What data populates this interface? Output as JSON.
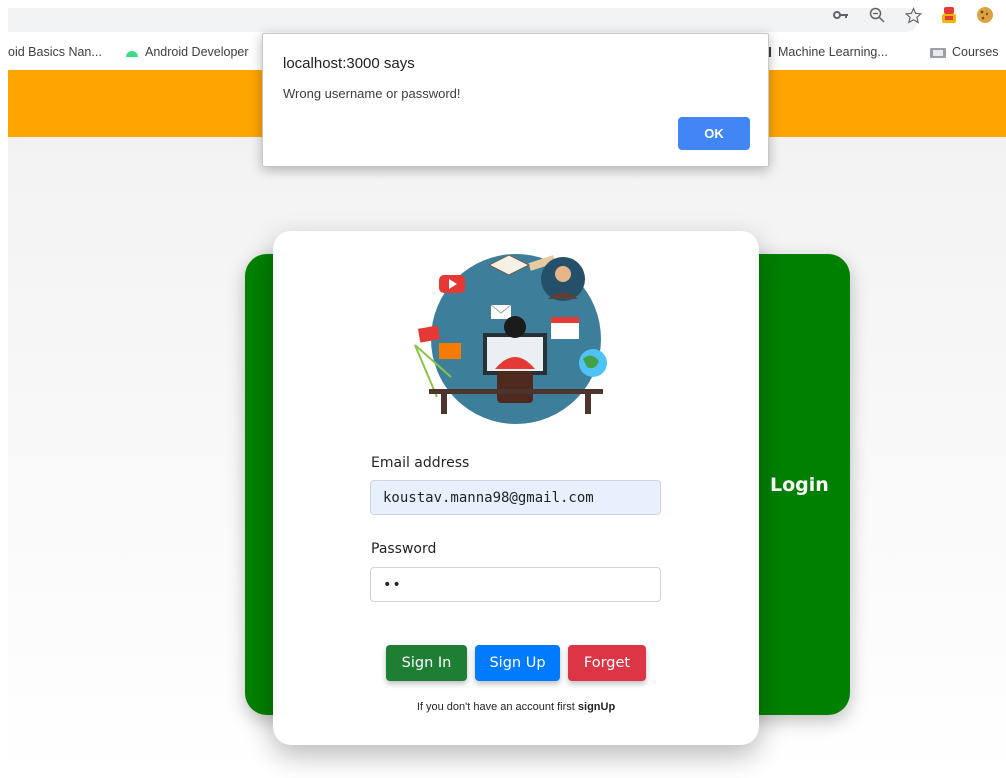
{
  "browser": {
    "bookmarks": [
      {
        "label": "oid Basics Nan...",
        "icon": "bookmark-icon"
      },
      {
        "label": "Android Developer",
        "icon": "android-icon"
      },
      {
        "label": "Machine Learning...",
        "icon": "folder-icon"
      },
      {
        "label": "Courses",
        "icon": "courses-icon"
      }
    ],
    "toolbar_icons": [
      "key-icon",
      "zoom-icon",
      "star-icon",
      "extension-icon",
      "cookie-icon"
    ]
  },
  "alert": {
    "title": "localhost:3000 says",
    "message": "Wrong username or password!",
    "ok_label": "OK"
  },
  "login": {
    "panel_title": "Login",
    "email_label": "Email address",
    "email_value": "koustav.manna98@gmail.com",
    "password_label": "Password",
    "password_value": "••",
    "signin_label": "Sign In",
    "signup_label": "Sign Up",
    "forget_label": "Forget",
    "hint_text": "If you don't have an account first ",
    "hint_link": "signUp"
  },
  "colors": {
    "topbar": "#ffa500",
    "green_card": "#008000",
    "signin": "#1e7e34",
    "signup": "#007bff",
    "forget": "#dc3545",
    "ok_button": "#4285f4"
  }
}
